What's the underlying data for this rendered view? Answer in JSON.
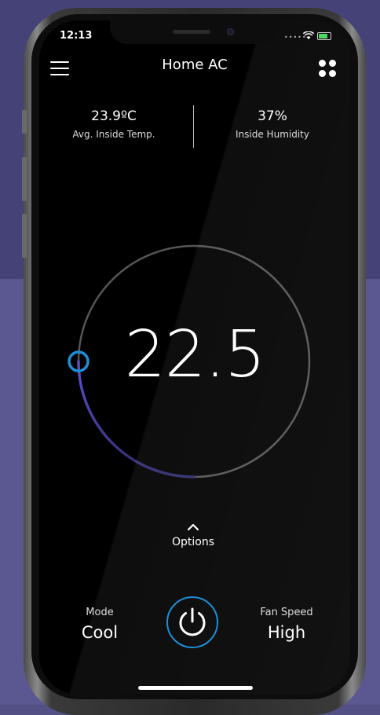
{
  "status_bar": {
    "time": "12:13"
  },
  "header": {
    "title": "Home AC",
    "menu_icon": "hamburger-menu-icon",
    "grid_icon": "four-dot-grid-icon"
  },
  "stats": {
    "temperature": {
      "value": "23.9ºC",
      "label": "Avg. Inside Temp."
    },
    "humidity": {
      "value": "37%",
      "label": "Inside Humidity"
    }
  },
  "dial": {
    "setpoint": "22.5",
    "level": 0.25,
    "track_color": "#555555",
    "arc_start_color": "#5a4fd0",
    "arc_end_color": "#2f2c6a",
    "knob_color": "#1d8fd6"
  },
  "options": {
    "chevron_icon": "chevron-up-icon",
    "label": "Options"
  },
  "controls": {
    "mode": {
      "label": "Mode",
      "value": "Cool"
    },
    "power_icon": "power-icon",
    "fan_speed": {
      "label": "Fan Speed",
      "value": "High"
    }
  }
}
